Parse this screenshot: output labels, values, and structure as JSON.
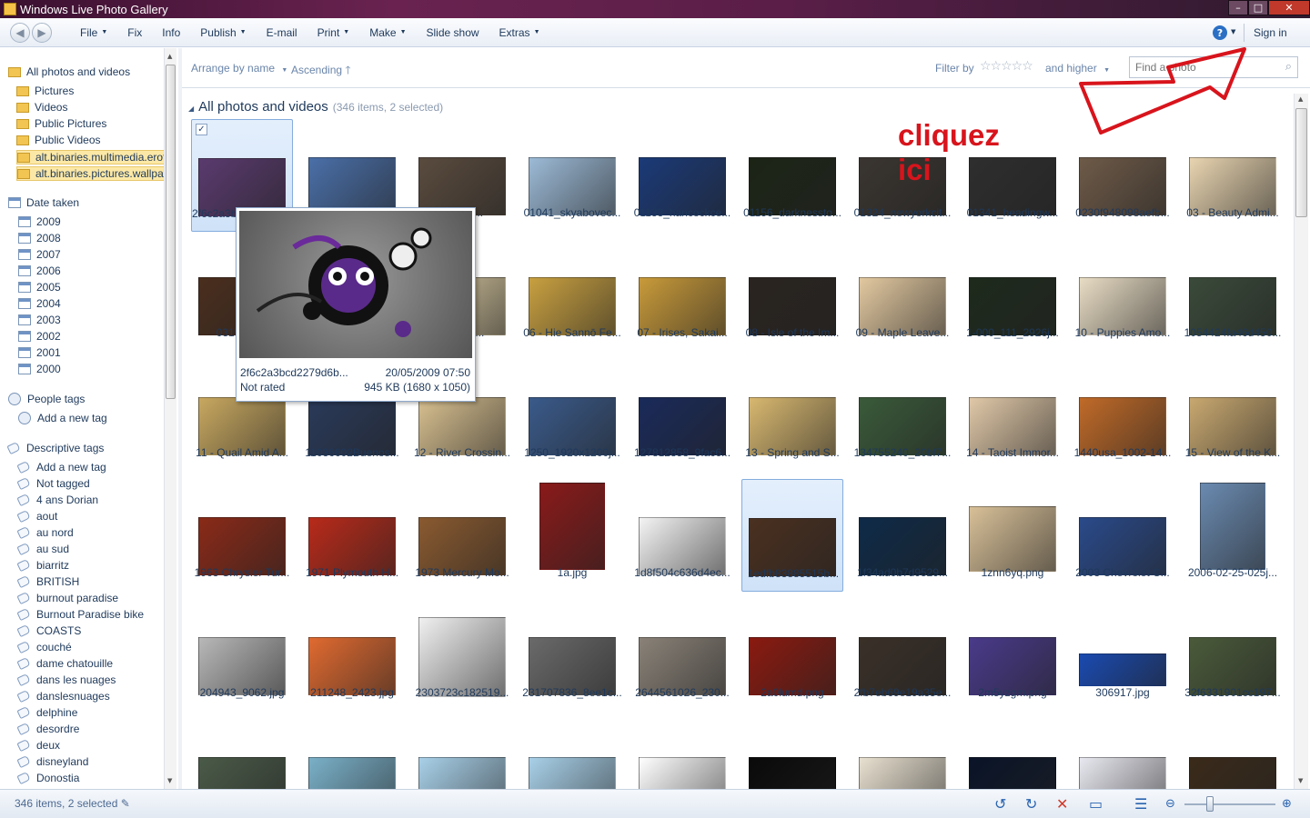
{
  "window": {
    "title": "Windows Live Photo Gallery"
  },
  "menu": {
    "items": [
      {
        "label": "File",
        "caret": true
      },
      {
        "label": "Fix",
        "caret": false
      },
      {
        "label": "Info",
        "caret": false
      },
      {
        "label": "Publish",
        "caret": true
      },
      {
        "label": "E-mail",
        "caret": false
      },
      {
        "label": "Print",
        "caret": true
      },
      {
        "label": "Make",
        "caret": true
      },
      {
        "label": "Slide show",
        "caret": false
      },
      {
        "label": "Extras",
        "caret": true
      }
    ],
    "help_glyph": "?",
    "sign_in": "Sign in"
  },
  "sidebar": {
    "root": "All photos and videos",
    "folders": [
      "Pictures",
      "Videos",
      "Public Pictures",
      "Public Videos",
      "alt.binaries.multimedia.erotica.amateur",
      "alt.binaries.pictures.wallpaper"
    ],
    "date_header": "Date taken",
    "years": [
      "2009",
      "2008",
      "2007",
      "2006",
      "2005",
      "2004",
      "2003",
      "2002",
      "2001",
      "2000"
    ],
    "people_header": "People tags",
    "people_add": "Add a new tag",
    "desc_header": "Descriptive tags",
    "desc_add": "Add a new tag",
    "desc_not_tagged": "Not tagged",
    "tags": [
      "4 ans Dorian",
      "aout",
      "au nord",
      "au sud",
      "biarritz",
      "BRITISH",
      "burnout paradise",
      "Burnout Paradise bike",
      "COASTS",
      "couché",
      "dame chatouille",
      "dans les nuages",
      "danslesnuages",
      "delphine",
      "desordre",
      "deux",
      "disneyland",
      "Donostia"
    ]
  },
  "toolbar": {
    "arrange": "Arrange by name",
    "order": "Ascending",
    "filter_label": "Filter by",
    "stars": "☆☆☆☆☆",
    "filter_scope": "and higher",
    "search_placeholder": "Find a photo"
  },
  "gallery": {
    "title": "All photos and videos",
    "count": "(346 items, 2 selected)",
    "tiles": [
      {
        "caption": "2f6c2a3bcd2279d6b...",
        "color": "#5a3a6e",
        "selected": true,
        "checked": true
      },
      {
        "caption": "",
        "color": "#4a6fa8"
      },
      {
        "caption": "...nemi...",
        "color": "#5a4b3e"
      },
      {
        "caption": "01041_skyabovec...",
        "color": "#9cbad6"
      },
      {
        "caption": "01133_hancockce...",
        "color": "#1b3a78"
      },
      {
        "caption": "01156_darknessto...",
        "color": "#1c2416"
      },
      {
        "caption": "01324_newyorkcit...",
        "color": "#3a3530"
      },
      {
        "caption": "01341_headingw...",
        "color": "#2e2e2e"
      },
      {
        "caption": "0230f948098aefb...",
        "color": "#6e5a48"
      },
      {
        "caption": "03 - Beauty Admi...",
        "color": "#e8d4b0"
      },
      {
        "caption": "031505_...",
        "color": "#4a2e1e"
      },
      {
        "caption": "",
        "color": "#7a7a7a"
      },
      {
        "caption": "...ancin...",
        "color": "#d8c8a0"
      },
      {
        "caption": "06 - Hie Sannō Fe...",
        "color": "#c8a040"
      },
      {
        "caption": "07 - Irises, Sakai...",
        "color": "#c89a3a"
      },
      {
        "caption": "08 - Isle of the Im...",
        "color": "#2a2420"
      },
      {
        "caption": "09 - Maple Leave...",
        "color": "#e2c8a0"
      },
      {
        "caption": "1-000_111_2926j...",
        "color": "#1e2a1c"
      },
      {
        "caption": "10 - Puppies Amo...",
        "color": "#e8dcc4"
      },
      {
        "caption": "1054424fa46d450...",
        "color": "#3a4a3a"
      },
      {
        "caption": "11 - Quail Amid A...",
        "color": "#c8a860"
      },
      {
        "caption": "11036602Buenos...",
        "color": "#2a3a5a"
      },
      {
        "caption": "12 - River Crossin...",
        "color": "#d8c090"
      },
      {
        "caption": "1250_1920x1200j...",
        "color": "#3a5a8a"
      },
      {
        "caption": "127812858_9fac6...",
        "color": "#1a2a5a"
      },
      {
        "caption": "13 - Spring and S...",
        "color": "#d8b870"
      },
      {
        "caption": "134755240_20bf7...",
        "color": "#3a5a3a"
      },
      {
        "caption": "14 - Taoist Immor...",
        "color": "#e0c8a8"
      },
      {
        "caption": "1440usa_1002-14...",
        "color": "#c06a28"
      },
      {
        "caption": "15 - View of the K...",
        "color": "#c8a870"
      },
      {
        "caption": "1963 Chrysler Tur...",
        "color": "#8a2a18"
      },
      {
        "caption": "1971 Plymouth H...",
        "color": "#b82a1a"
      },
      {
        "caption": "1973 Mercury Mo...",
        "color": "#8a5a30"
      },
      {
        "caption": "1a.jpg",
        "color": "#8a1a1a"
      },
      {
        "caption": "1d8f504c636d4ec...",
        "color": "#f4f4f4"
      },
      {
        "caption": "1edfb83885515b...",
        "color": "#4a3020",
        "selected": true
      },
      {
        "caption": "1f34ad0b7d9529...",
        "color": "#0e2a48"
      },
      {
        "caption": "1znn6yq.png",
        "color": "#d8c098"
      },
      {
        "caption": "2003 Chevrolet C...",
        "color": "#2a4a8a"
      },
      {
        "caption": "2006-02-25-025j...",
        "color": "#6a8ab0"
      },
      {
        "caption": "204943_9062.jpg",
        "color": "#b8b8b8"
      },
      {
        "caption": "211248_2423.jpg",
        "color": "#e06a30"
      },
      {
        "caption": "2303723c182519...",
        "color": "#f0f0f0"
      },
      {
        "caption": "231707836_8ee1c...",
        "color": "#6a6a6a"
      },
      {
        "caption": "2644561026_230...",
        "color": "#8a8278"
      },
      {
        "caption": "2a0lumd.png",
        "color": "#8a1a10"
      },
      {
        "caption": "2fb7eb69e19a35e...",
        "color": "#3a3028"
      },
      {
        "caption": "2m5yzgm.png",
        "color": "#4a3a8a"
      },
      {
        "caption": "306917.jpg",
        "color": "#1a4ab0"
      },
      {
        "caption": "32f6331901cc197...",
        "color": "#4a5a3a"
      },
      {
        "caption": "",
        "color": "#4a5a48"
      },
      {
        "caption": "",
        "color": "#7ab0c8"
      },
      {
        "caption": "",
        "color": "#a8d0e8"
      },
      {
        "caption": "",
        "color": "#a8d0e8"
      },
      {
        "caption": "",
        "color": "#ffffff"
      },
      {
        "caption": "",
        "color": "#0a0a0a"
      },
      {
        "caption": "",
        "color": "#e8e0d0"
      },
      {
        "caption": "",
        "color": "#0a1428"
      },
      {
        "caption": "",
        "color": "#e8e8f0"
      },
      {
        "caption": "",
        "color": "#3a2a1a"
      }
    ]
  },
  "preview": {
    "filename": "2f6c2a3bcd2279d6b...",
    "date": "20/05/2009 07:50",
    "rating": "Not rated",
    "size": "945 KB (1680 x 1050)"
  },
  "annotation": {
    "line1": "cliquez",
    "line2": "ici",
    "color": "#d8141c"
  },
  "status": {
    "text": "346 items, 2 selected"
  }
}
